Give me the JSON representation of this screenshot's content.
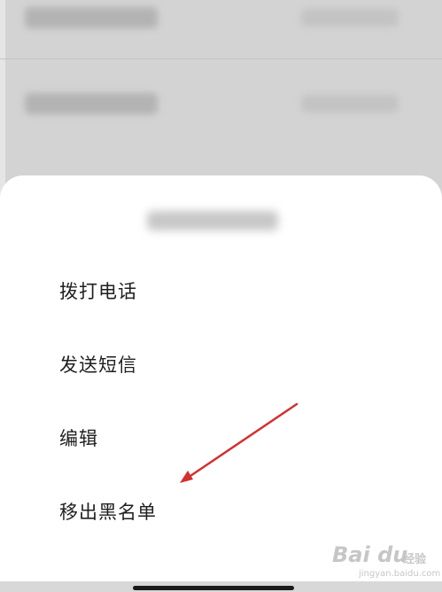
{
  "menu": {
    "items": [
      {
        "label": "拨打电话"
      },
      {
        "label": "发送短信"
      },
      {
        "label": "编辑"
      },
      {
        "label": "移出黑名单"
      }
    ]
  },
  "watermark": {
    "logo": "Bai du",
    "cn": "经验",
    "url": "jingyan.baidu.com"
  },
  "colors": {
    "sheet_background": "#ffffff",
    "dimmed_background": "#cfcfcf",
    "annotation_arrow": "#d32f2f",
    "text": "#1f1f1f"
  },
  "icons": [
    "annotation-arrow",
    "home-indicator"
  ]
}
